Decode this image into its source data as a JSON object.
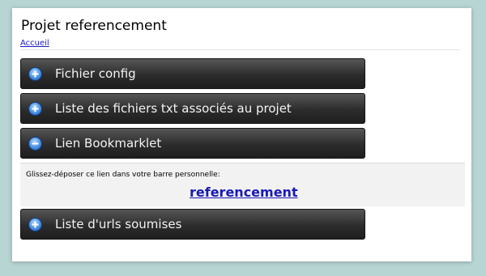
{
  "page": {
    "title": "Projet referencement",
    "breadcrumb": "Accueil"
  },
  "accordion": [
    {
      "label": "Fichier config",
      "state": "collapsed"
    },
    {
      "label": "Liste des fichiers txt associés au projet",
      "state": "collapsed"
    },
    {
      "label": "Lien Bookmarklet",
      "state": "expanded"
    },
    {
      "label": "Liste d'urls soumises",
      "state": "collapsed"
    }
  ],
  "bookmarklet": {
    "hint": "Glissez-déposer ce lien dans votre barre personnelle:",
    "link_text": "referencement"
  },
  "colors": {
    "background": "#b7d5d3",
    "panel": "#ffffff",
    "accordion_header": "#2c2c2c",
    "icon": "#4a90e0",
    "link": "#1919b8"
  }
}
